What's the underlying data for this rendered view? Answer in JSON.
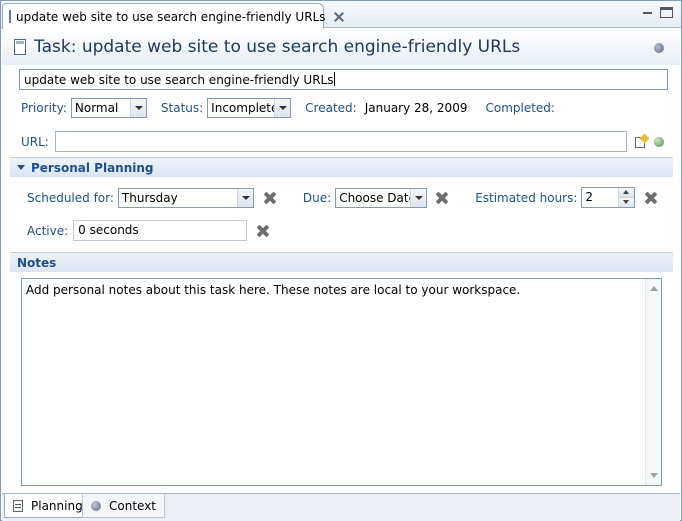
{
  "tab": {
    "title": "update web site to use search engine-friendly URLs"
  },
  "header": {
    "title": "Task: update web site to use search engine-friendly URLs"
  },
  "summary": {
    "value": "update web site to use search engine-friendly URLs"
  },
  "attributes": {
    "priority_label": "Priority:",
    "priority_value": "Normal",
    "status_label": "Status:",
    "status_value": "Incomplete",
    "created_label": "Created:",
    "created_value": "January 28, 2009",
    "completed_label": "Completed:"
  },
  "url": {
    "label": "URL:",
    "value": ""
  },
  "personal_planning": {
    "title": "Personal Planning",
    "scheduled_label": "Scheduled for:",
    "scheduled_value": "Thursday",
    "due_label": "Due:",
    "due_value": "Choose Date",
    "estimated_label": "Estimated hours:",
    "estimated_value": "2",
    "active_label": "Active:",
    "active_value": "0 seconds"
  },
  "notes": {
    "title": "Notes",
    "text": "Add personal notes about this task here. These notes are local to your workspace."
  },
  "bottom_tabs": [
    {
      "label": "Planning",
      "icon": "planning-icon",
      "active": true
    },
    {
      "label": "Context",
      "icon": "context-icon",
      "active": false
    }
  ],
  "colors": {
    "label_blue": "#1f4f8f",
    "title_blue": "#1f3a60",
    "border": "#7f9db9"
  }
}
